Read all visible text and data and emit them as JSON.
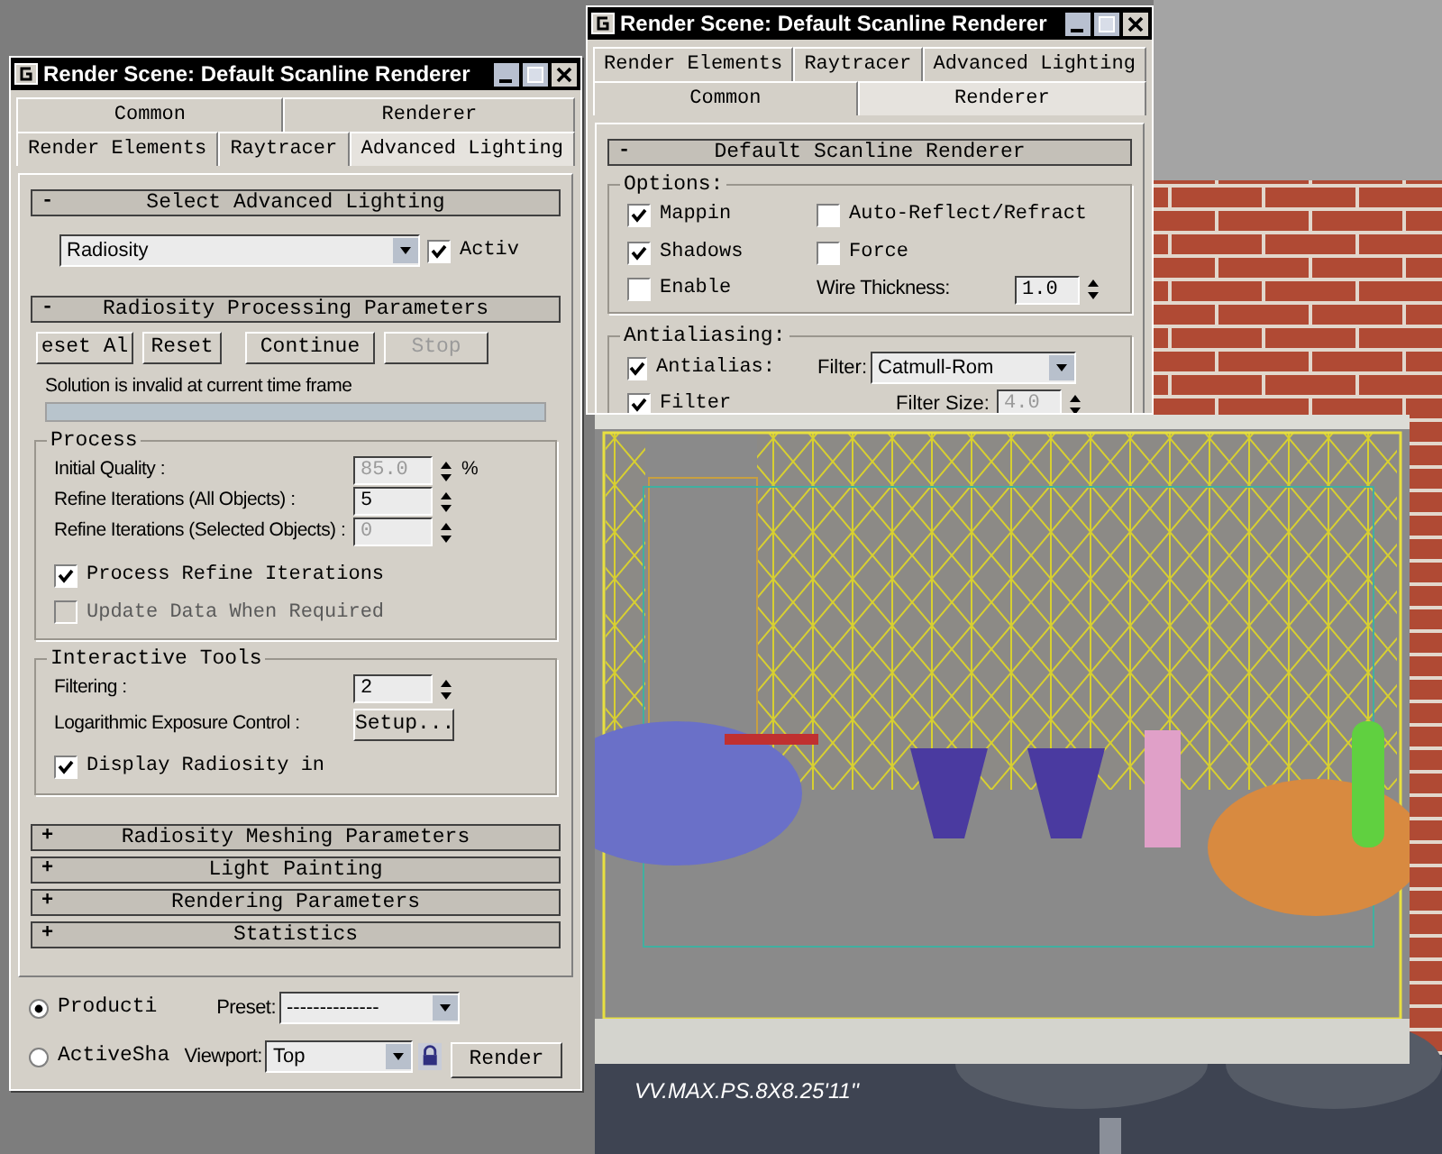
{
  "left_dialog": {
    "title": "Render Scene: Default Scanline Renderer",
    "tab_rows": [
      {
        "tabs": [
          {
            "label": "Common",
            "selected": false
          },
          {
            "label": "Renderer",
            "selected": false
          }
        ]
      },
      {
        "tabs": [
          {
            "label": "Render Elements",
            "selected": false
          },
          {
            "label": "Raytracer",
            "selected": false
          },
          {
            "label": "Advanced Lighting",
            "selected": true
          }
        ]
      }
    ],
    "select_rollout": {
      "sign": "-",
      "title": "Select Advanced Lighting",
      "dropdown": "Radiosity",
      "active": {
        "label": "Activ",
        "checked": true
      }
    },
    "processing_rollout": {
      "sign": "-",
      "title": "Radiosity Processing Parameters",
      "buttons": [
        {
          "label": "eset Al",
          "disabled": false
        },
        {
          "label": "Reset",
          "disabled": false
        },
        {
          "label": "Continue",
          "disabled": false
        },
        {
          "label": "Stop",
          "disabled": true
        }
      ],
      "status": "Solution is invalid at current time frame",
      "progress": {
        "level": 0
      },
      "process_group": {
        "title": "Process",
        "fields": [
          {
            "label": "Initial Quality :",
            "value": "85.0",
            "unit": "%",
            "disabled": true
          },
          {
            "label": "Refine Iterations (All Objects) :",
            "value": "5",
            "disabled": false
          },
          {
            "label": "Refine Iterations (Selected Objects) :",
            "value": "0",
            "disabled": true
          }
        ],
        "checks": [
          {
            "label": "Process Refine Iterations",
            "checked": true,
            "disabled": false
          },
          {
            "label": "Update Data When Required",
            "checked": false,
            "disabled": true
          }
        ]
      },
      "tools_group": {
        "title": "Interactive Tools",
        "filtering": {
          "label": "Filtering :",
          "value": "2"
        },
        "exposure": {
          "label": "Logarithmic Exposure Control :",
          "button": "Setup..."
        },
        "display": {
          "label": "Display Radiosity in",
          "checked": true
        }
      }
    },
    "collapsed_rollouts": [
      {
        "sign": "+",
        "title": "Radiosity Meshing Parameters"
      },
      {
        "sign": "+",
        "title": "Light Painting"
      },
      {
        "sign": "+",
        "title": "Rendering Parameters"
      },
      {
        "sign": "+",
        "title": "Statistics"
      }
    ],
    "footer": {
      "modes": [
        {
          "label": "Producti",
          "selected": true
        },
        {
          "label": "ActiveSha",
          "selected": false
        }
      ],
      "preset": {
        "label": "Preset:",
        "value": "--------------"
      },
      "viewport": {
        "label": "Viewport:",
        "value": "Top"
      },
      "render_button": "Render"
    }
  },
  "right_dialog": {
    "title": "Render Scene: Default Scanline Renderer",
    "tab_rows": [
      {
        "tabs": [
          {
            "label": "Render Elements",
            "selected": false
          },
          {
            "label": "Raytracer",
            "selected": false
          },
          {
            "label": "Advanced Lighting",
            "selected": false
          }
        ]
      },
      {
        "tabs": [
          {
            "label": "Common",
            "selected": false
          },
          {
            "label": "Renderer",
            "selected": true
          }
        ]
      }
    ],
    "rollout": {
      "sign": "-",
      "title": "Default Scanline Renderer"
    },
    "options_group": {
      "title": "Options:",
      "checks": [
        {
          "label": "Mappin",
          "checked": true
        },
        {
          "label": "Shadows",
          "checked": true
        },
        {
          "label": "Enable",
          "checked": false
        },
        {
          "label": "Auto-Reflect/Refract",
          "checked": false
        },
        {
          "label": "Force",
          "checked": false
        }
      ],
      "wire": {
        "label": "Wire Thickness:",
        "value": "1.0"
      }
    },
    "antialiasing_group": {
      "title": "Antialiasing:",
      "antialias": {
        "label": "Antialias:",
        "checked": true
      },
      "filter_label": "Filter:",
      "filter_value": "Catmull-Rom",
      "filter_check": {
        "label": "Filter",
        "checked": true
      },
      "size": {
        "label": "Filter Size:",
        "value": "4.0",
        "disabled": true
      }
    }
  },
  "caption": "VV.MAX.PS.8X8.25'11''"
}
